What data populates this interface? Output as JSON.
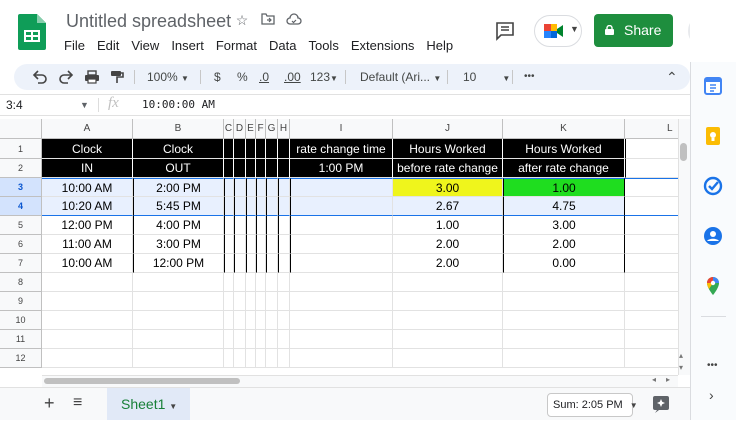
{
  "doc": {
    "title": "Untitled spreadsheet"
  },
  "menu": [
    "File",
    "Edit",
    "View",
    "Insert",
    "Format",
    "Data",
    "Tools",
    "Extensions",
    "Help"
  ],
  "share_label": "Share",
  "toolbar": {
    "zoom": "100%",
    "currency": "$",
    "percent": "%",
    "dec_less": ".0",
    "dec_more": ".00",
    "more_formats": "123",
    "font": "Default (Ari...",
    "font_size": "10",
    "more": "•••"
  },
  "formula_bar": {
    "name_box": "3:4",
    "fx": "fx",
    "formula": "10:00:00 AM"
  },
  "columns": [
    "A",
    "B",
    "C",
    "D",
    "E",
    "F",
    "G",
    "H",
    "I",
    "J",
    "K",
    "L"
  ],
  "rows": [
    "1",
    "2",
    "3",
    "4",
    "5",
    "6",
    "7",
    "8",
    "9",
    "10",
    "11",
    "12"
  ],
  "headers": {
    "a1": "Clock",
    "a2": "IN",
    "b1": "Clock",
    "b2": "OUT",
    "i1": "rate change time",
    "i2": "1:00 PM",
    "j1": "Hours Worked",
    "j2": "before rate change",
    "k1": "Hours Worked",
    "k2": "after rate change"
  },
  "data_rows": [
    {
      "a": "10:00 AM",
      "b": "2:00 PM",
      "j": "3.00",
      "k": "1.00"
    },
    {
      "a": "10:20 AM",
      "b": "5:45 PM",
      "j": "2.67",
      "k": "4.75"
    },
    {
      "a": "12:00 PM",
      "b": "4:00 PM",
      "j": "1.00",
      "k": "3.00"
    },
    {
      "a": "11:00 AM",
      "b": "3:00 PM",
      "j": "2.00",
      "k": "2.00"
    },
    {
      "a": "10:00 AM",
      "b": "12:00 PM",
      "j": "2.00",
      "k": "0.00"
    }
  ],
  "colors": {
    "yellow": "#eff51c",
    "green": "#1fdd1f",
    "share_green": "#1e8e3e",
    "selection": "#e8f0fe"
  },
  "bottom": {
    "add": "+",
    "list": "≡",
    "sheet_tab": "Sheet1",
    "sum": "Sum: 2:05 PM"
  },
  "side_icons": [
    "calendar-icon",
    "keep-icon",
    "tasks-icon",
    "contacts-icon",
    "maps-icon"
  ],
  "side_more": "•••"
}
